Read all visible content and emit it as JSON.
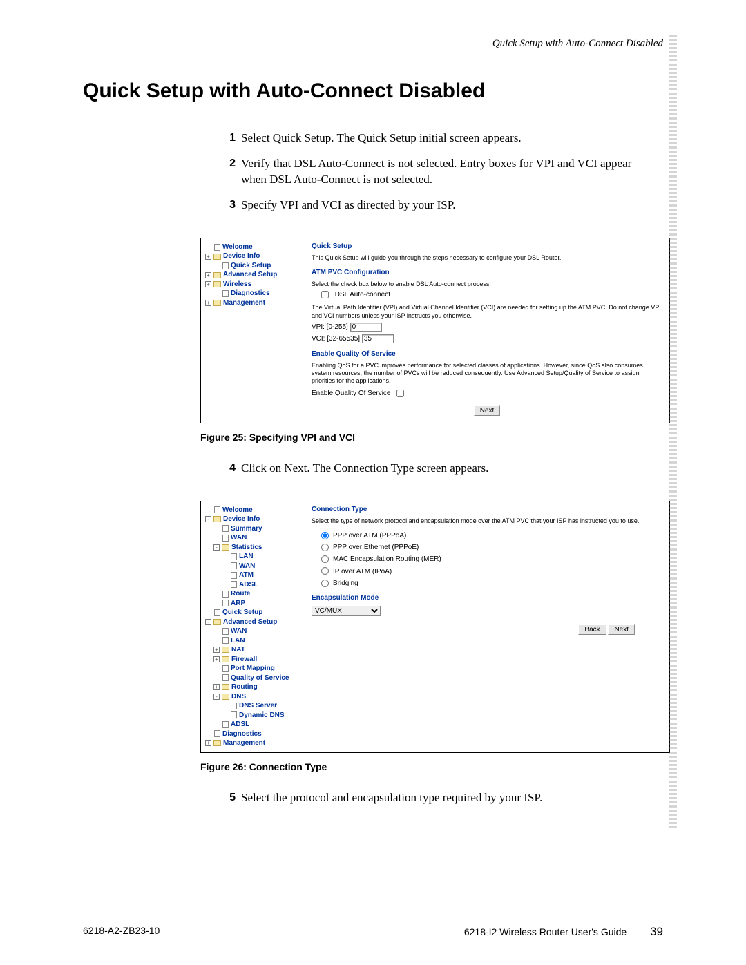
{
  "header": {
    "running": "Quick Setup with Auto-Connect Disabled"
  },
  "title": "Quick Setup with Auto-Connect Disabled",
  "steps_a": [
    {
      "n": "1",
      "t": "Select Quick Setup. The Quick Setup initial screen appears."
    },
    {
      "n": "2",
      "t": "Verify that DSL Auto-Connect is not selected. Entry boxes for VPI and VCI appear when DSL Auto-Connect is not selected."
    },
    {
      "n": "3",
      "t": "Specify VPI and VCI as directed by your ISP."
    }
  ],
  "fig25": {
    "caption": "Figure 25: Specifying VPI and VCI",
    "nav": [
      {
        "label": "Welcome",
        "indent": 0,
        "icon": "doc",
        "exp": ""
      },
      {
        "label": "Device Info",
        "indent": 0,
        "icon": "fold",
        "exp": "+"
      },
      {
        "label": "Quick Setup",
        "indent": 1,
        "icon": "doc",
        "exp": ""
      },
      {
        "label": "Advanced Setup",
        "indent": 0,
        "icon": "fold",
        "exp": "+"
      },
      {
        "label": "Wireless",
        "indent": 0,
        "icon": "fold",
        "exp": "+"
      },
      {
        "label": "Diagnostics",
        "indent": 1,
        "icon": "doc",
        "exp": ""
      },
      {
        "label": "Management",
        "indent": 0,
        "icon": "fold",
        "exp": "+"
      }
    ],
    "main": {
      "title": "Quick Setup",
      "intro": "This Quick Setup will guide you through the steps necessary to configure your DSL Router.",
      "atm_header": "ATM PVC Configuration",
      "atm_intro": "Select the check box below to enable DSL Auto-connect process.",
      "auto_label": "DSL Auto-connect",
      "vpi_vci_note": "The Virtual Path Identifier (VPI) and Virtual Channel Identifier (VCI) are needed for setting up the ATM PVC. Do not change VPI and VCI numbers unless your ISP instructs you otherwise.",
      "vpi_label": "VPI: [0-255]",
      "vpi_value": "0",
      "vci_label": "VCI: [32-65535]",
      "vci_value": "35",
      "qos_header": "Enable Quality Of Service",
      "qos_note": "Enabling QoS for a PVC improves performance for selected classes of applications. However, since QoS also consumes system resources, the number of PVCs will be reduced consequently. Use Advanced Setup/Quality of Service to assign priorities for the applications.",
      "qos_label": "Enable Quality Of Service",
      "next": "Next"
    }
  },
  "steps_b": [
    {
      "n": "4",
      "t": "Click on Next. The Connection Type screen appears."
    }
  ],
  "fig26": {
    "caption": "Figure 26: Connection Type",
    "nav": [
      {
        "label": "Welcome",
        "indent": 0,
        "icon": "doc",
        "exp": ""
      },
      {
        "label": "Device Info",
        "indent": 0,
        "icon": "fold",
        "exp": "-"
      },
      {
        "label": "Summary",
        "indent": 1,
        "icon": "doc",
        "exp": ""
      },
      {
        "label": "WAN",
        "indent": 1,
        "icon": "doc",
        "exp": ""
      },
      {
        "label": "Statistics",
        "indent": 1,
        "icon": "fold",
        "exp": "-"
      },
      {
        "label": "LAN",
        "indent": 2,
        "icon": "doc",
        "exp": ""
      },
      {
        "label": "WAN",
        "indent": 2,
        "icon": "doc",
        "exp": ""
      },
      {
        "label": "ATM",
        "indent": 2,
        "icon": "doc",
        "exp": ""
      },
      {
        "label": "ADSL",
        "indent": 2,
        "icon": "doc",
        "exp": ""
      },
      {
        "label": "Route",
        "indent": 1,
        "icon": "doc",
        "exp": ""
      },
      {
        "label": "ARP",
        "indent": 1,
        "icon": "doc",
        "exp": ""
      },
      {
        "label": "Quick Setup",
        "indent": 0,
        "icon": "doc",
        "exp": ""
      },
      {
        "label": "Advanced Setup",
        "indent": 0,
        "icon": "fold",
        "exp": "-"
      },
      {
        "label": "WAN",
        "indent": 1,
        "icon": "doc",
        "exp": ""
      },
      {
        "label": "LAN",
        "indent": 1,
        "icon": "doc",
        "exp": ""
      },
      {
        "label": "NAT",
        "indent": 1,
        "icon": "fold",
        "exp": "+"
      },
      {
        "label": "Firewall",
        "indent": 1,
        "icon": "fold",
        "exp": "+"
      },
      {
        "label": "Port Mapping",
        "indent": 1,
        "icon": "doc",
        "exp": ""
      },
      {
        "label": "Quality of Service",
        "indent": 1,
        "icon": "doc",
        "exp": ""
      },
      {
        "label": "Routing",
        "indent": 1,
        "icon": "fold",
        "exp": "+"
      },
      {
        "label": "DNS",
        "indent": 1,
        "icon": "fold",
        "exp": "-"
      },
      {
        "label": "DNS Server",
        "indent": 2,
        "icon": "doc",
        "exp": ""
      },
      {
        "label": "Dynamic DNS",
        "indent": 2,
        "icon": "doc",
        "exp": ""
      },
      {
        "label": "ADSL",
        "indent": 1,
        "icon": "doc",
        "exp": ""
      },
      {
        "label": "Diagnostics",
        "indent": 0,
        "icon": "doc",
        "exp": ""
      },
      {
        "label": "Management",
        "indent": 0,
        "icon": "fold",
        "exp": "+"
      }
    ],
    "main": {
      "title": "Connection Type",
      "intro": "Select the type of network protocol and encapsulation mode over the ATM PVC that your ISP has instructed you to use.",
      "opts": [
        "PPP over ATM (PPPoA)",
        "PPP over Ethernet (PPPoE)",
        "MAC Encapsulation Routing (MER)",
        "IP over ATM (IPoA)",
        "Bridging"
      ],
      "selected_index": 0,
      "encap_header": "Encapsulation Mode",
      "encap_value": "VC/MUX",
      "back": "Back",
      "next": "Next"
    }
  },
  "steps_c": [
    {
      "n": "5",
      "t": "Select the protocol and encapsulation type required by your ISP."
    }
  ],
  "footer": {
    "left": "6218-A2-ZB23-10",
    "right": "6218-I2 Wireless Router User's Guide",
    "page": "39"
  }
}
